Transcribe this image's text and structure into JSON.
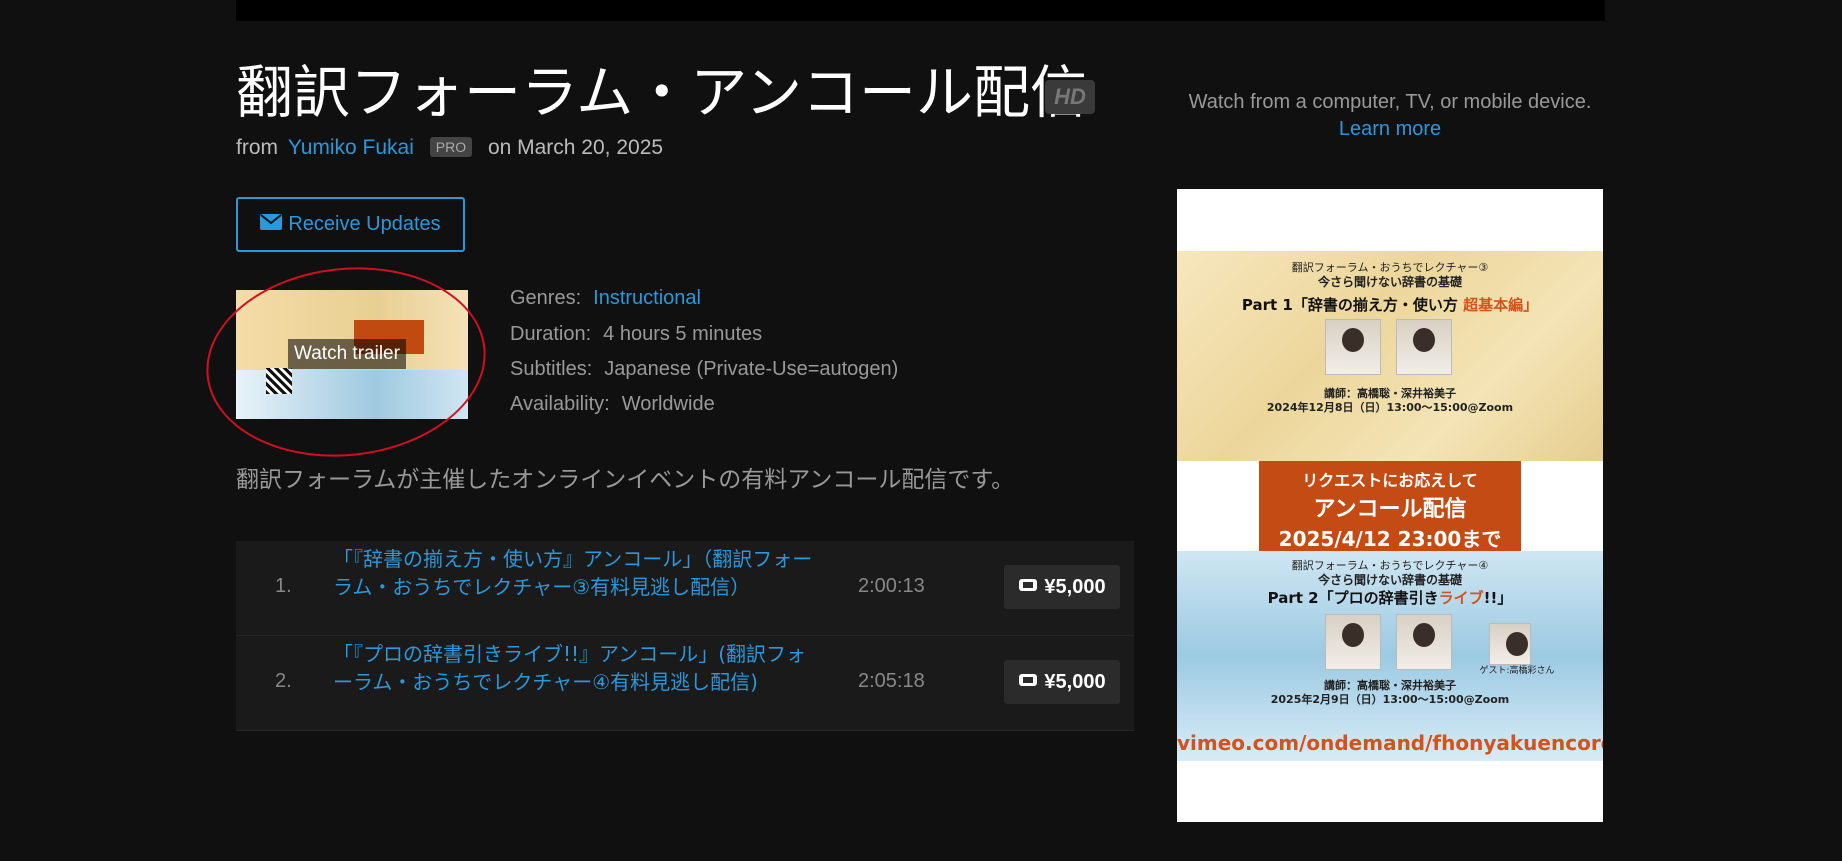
{
  "header": {
    "title": "翻訳フォーラム・アンコール配信",
    "hd_badge": "HD",
    "from_label": "from",
    "author": "Yumiko Fukai",
    "pro_badge": "PRO",
    "date": "on March 20, 2025"
  },
  "actions": {
    "receive_updates": "Receive Updates",
    "watch_trailer": "Watch trailer"
  },
  "details": {
    "genres_label": "Genres:",
    "genres_value": "Instructional",
    "duration_label": "Duration:",
    "duration_value": "4 hours 5 minutes",
    "subtitles_label": "Subtitles:",
    "subtitles_value": "Japanese (Private-Use=autogen)",
    "availability_label": "Availability:",
    "availability_value": "Worldwide"
  },
  "description": "翻訳フォーラムが主催したオンラインイベントの有料アンコール配信です。",
  "episodes": [
    {
      "num": "1.",
      "title": "「『辞書の揃え方・使い方』アンコール」（翻訳フォーラム・おうちでレクチャー③有料見逃し配信）",
      "duration": "2:00:13",
      "price": "¥5,000"
    },
    {
      "num": "2.",
      "title": "「『プロの辞書引きライブ!!』アンコール」(翻訳フォーラム・おうちでレクチャー④有料見逃し配信)",
      "duration": "2:05:18",
      "price": "¥5,000"
    }
  ],
  "sidebar": {
    "watch_from": "Watch from a computer, TV, or mobile device.",
    "learn_more": "Learn more"
  },
  "poster": {
    "top_series": "翻訳フォーラム・おうちでレクチャー③",
    "top_subtitle": "今さら聞けない辞書の基礎",
    "top_part_a": "Part 1「辞書の揃え方・使い方",
    "top_part_b": "超基本編」",
    "top_lecturers": "講師：高橋聡・深井裕美子",
    "top_date": "2024年12月8日（日）13:00〜15:00@Zoom",
    "banner_1": "リクエストにお応えして",
    "banner_2": "アンコール配信",
    "banner_3": "2025/4/12 23:00まで",
    "bot_series": "翻訳フォーラム・おうちでレクチャー④",
    "bot_subtitle": "今さら聞けない辞書の基礎",
    "bot_part_a": "Part 2「プロの辞書引き",
    "bot_part_b": "ライブ",
    "bot_part_c": "!!」",
    "bot_guest": "ゲスト:高橋彩さん",
    "bot_lecturers": "講師：高橋聡・深井裕美子",
    "bot_date": "2025年2月9日（日）13:00〜15:00@Zoom",
    "url": "vimeo.com/ondemand/fhonyakuencore",
    "accent_color": "#d4531a"
  },
  "colors": {
    "link": "#2a98dc",
    "background": "#101010"
  }
}
